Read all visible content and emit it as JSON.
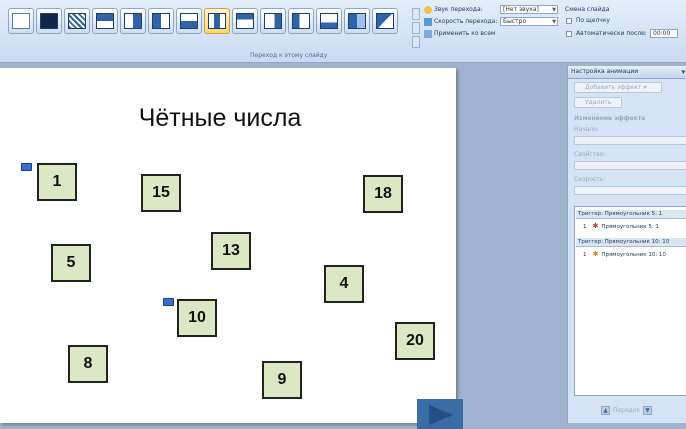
{
  "ribbon": {
    "group_label": "Переход к этому слайду",
    "sound_label": "Звук перехода:",
    "sound_value": "[Нет звука]",
    "speed_label": "Скорость перехода:",
    "speed_value": "Быстро",
    "apply_all_label": "Применить ко всем",
    "advance_title": "Смена слайда",
    "on_click_label": "По щелчку",
    "auto_after_label": "Автоматически после:",
    "auto_after_value": "00:00"
  },
  "slide": {
    "title": "Чётные числа",
    "numbers": [
      "1",
      "15",
      "18",
      "5",
      "13",
      "4",
      "10",
      "20",
      "8",
      "9"
    ]
  },
  "pane": {
    "title": "Настройка анимации",
    "add_effect": "Добавить эффект",
    "remove": "Удалить",
    "change_effect": "Изменение эффекта",
    "start_label": "Начало:",
    "property_label": "Свойство:",
    "speed_label": "Скорость:",
    "trigger1": "Триггер: Прямоугольник 5: 1",
    "item1": "Прямоугольник 5: 1",
    "trigger2": "Триггер: Прямоугольник 10: 10",
    "item2": "Прямоугольник 10: 10",
    "item_index": "1",
    "order_label": "Порядок"
  }
}
